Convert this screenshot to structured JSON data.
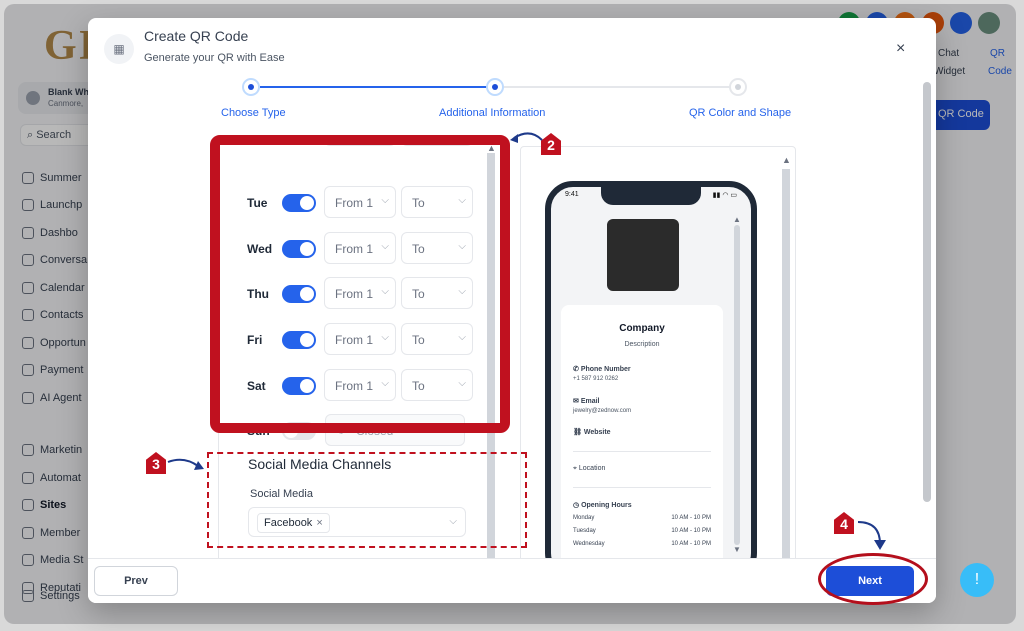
{
  "app": {
    "logo": "GI",
    "account_name": "Blank Wh",
    "account_location": "Canmore,",
    "search_label": "Search",
    "nav": [
      "Summer",
      "Launchp",
      "Dashbo",
      "Conversa",
      "Calendar",
      "Contacts",
      "Opportun",
      "Payment",
      "AI Agent",
      "Marketin",
      "Automat",
      "Sites",
      "Member",
      "Media St",
      "Reputati",
      "Settings"
    ],
    "right_tabs": [
      "Chat",
      "Widget",
      "QR",
      "Code"
    ],
    "qr_button": "QR Code",
    "feedback_icon": "!"
  },
  "modal": {
    "icon": "qr-icon",
    "title": "Create QR Code",
    "subtitle": "Generate your QR with Ease",
    "close": "×",
    "steps": [
      "Choose Type",
      "Additional Information",
      "QR Color and Shape"
    ],
    "accent": "#2563eb"
  },
  "hours": [
    {
      "day": "Tue",
      "on": true,
      "from": "From",
      "to": "To"
    },
    {
      "day": "Wed",
      "on": true,
      "from": "From",
      "to": "To"
    },
    {
      "day": "Thu",
      "on": true,
      "from": "From",
      "to": "To"
    },
    {
      "day": "Fri",
      "on": true,
      "from": "From",
      "to": "To"
    },
    {
      "day": "Sat",
      "on": true,
      "from": "From",
      "to": "To"
    },
    {
      "day": "Sun",
      "on": false,
      "closed": "Closed"
    }
  ],
  "social": {
    "title": "Social Media Channels",
    "label": "Social Media",
    "chip": "Facebook",
    "chip_remove": "×"
  },
  "preview": {
    "time": "9:41",
    "company": "Company",
    "description": "Description",
    "phone_label": "Phone Number",
    "phone_value": "+1 587 912 0262",
    "email_label": "Email",
    "email_value": "jewelry@zednow.com",
    "website_label": "Website",
    "location_label": "Location",
    "hours_label": "Opening Hours",
    "hours": [
      {
        "day": "Monday",
        "value": "10 AM - 10 PM"
      },
      {
        "day": "Tuesday",
        "value": "10 AM - 10 PM"
      },
      {
        "day": "Wednesday",
        "value": "10 AM - 10 PM"
      }
    ]
  },
  "footer": {
    "prev": "Prev",
    "next": "Next"
  },
  "annotations": [
    "2",
    "3",
    "4"
  ],
  "colors": {
    "annotation_red": "#c0111f",
    "primary_blue": "#1d4ed8"
  }
}
